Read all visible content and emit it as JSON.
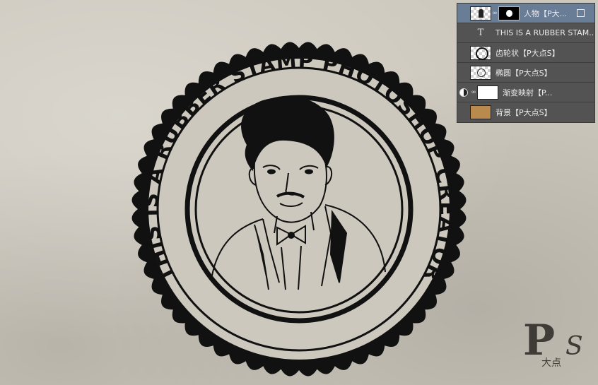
{
  "canvas": {
    "stamp_text": "THIS IS A RUBBER STAMP PHOTOSHOP CREATOR"
  },
  "layers_panel": {
    "layers": [
      {
        "name": "人物【P大...",
        "thumb": "person-thumbnail",
        "mask": "white-oval-mask",
        "selected": true,
        "smart_object": true
      },
      {
        "name": "THIS IS A RUBBER STAM...",
        "thumb": "text-layer-T",
        "selected": false
      },
      {
        "name": "齿轮状【P大点S】",
        "thumb": "gear-thumbnail",
        "selected": false
      },
      {
        "name": "椭圆【P大点S】",
        "thumb": "ellipse-thumbnail",
        "selected": false
      },
      {
        "name": "渐变映射【P...",
        "thumb": "gradient-map-adjustment",
        "selected": false
      },
      {
        "name": "背景【P大点S】",
        "thumb": "paper-texture-thumbnail",
        "selected": false
      }
    ]
  },
  "watermark": {
    "main": "P",
    "sub": "大点",
    "tail": "S"
  },
  "colors": {
    "paper": "#cdc8bd",
    "ink": "#111111",
    "panel_bg": "#535353",
    "panel_selected": "#6a7d96",
    "bg_thumb": "#b98a4e"
  }
}
